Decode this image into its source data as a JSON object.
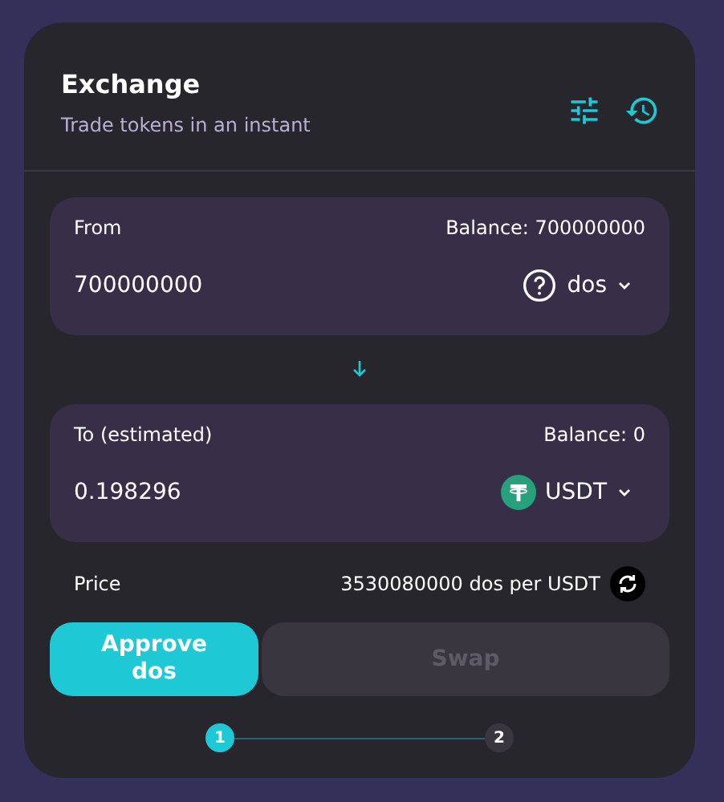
{
  "header": {
    "title": "Exchange",
    "subtitle": "Trade tokens in an instant"
  },
  "panels": [
    {
      "label": "From",
      "balance": "Balance: 700000000",
      "value": "700000000",
      "token": {
        "kind": "unknown",
        "symbol": "dos"
      }
    },
    {
      "label": "To (estimated)",
      "balance": "Balance: 0",
      "value": "0.198296",
      "token": {
        "kind": "tether",
        "symbol": "USDT"
      }
    }
  ],
  "price": {
    "label": "Price",
    "value": "3530080000 dos per USDT"
  },
  "buttons": [
    {
      "label": "Approve dos",
      "disabled": false
    },
    {
      "label": "Swap",
      "disabled": true
    }
  ],
  "steps": [
    {
      "label": "1",
      "selected": true
    },
    {
      "label": "2",
      "selected": false
    }
  ]
}
